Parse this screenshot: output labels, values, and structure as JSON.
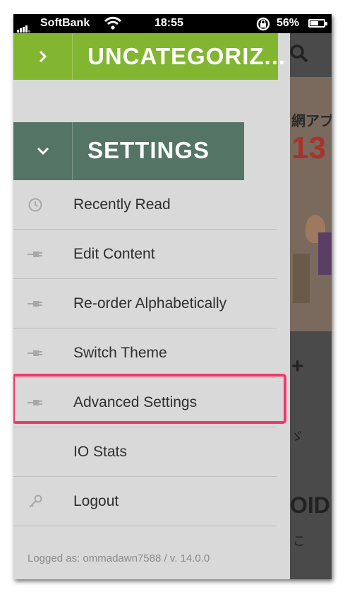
{
  "status_bar": {
    "carrier": "SoftBank",
    "time": "18:55",
    "battery": "56%"
  },
  "drawer": {
    "category_collapsed": {
      "label": "UNCATEGORIZ...",
      "icon": "chevron-right-icon"
    },
    "category_expanded": {
      "label": "SETTINGS",
      "icon": "chevron-down-icon"
    },
    "items": [
      {
        "label": "Recently Read",
        "icon": "clock-icon"
      },
      {
        "label": "Edit Content",
        "icon": "plug-icon"
      },
      {
        "label": "Re-order Alphabetically",
        "icon": "plug-icon"
      },
      {
        "label": "Switch Theme",
        "icon": "plug-icon"
      },
      {
        "label": "Advanced Settings",
        "icon": "plug-icon",
        "highlighted": true
      },
      {
        "label": "IO Stats",
        "icon": ""
      },
      {
        "label": "Logout",
        "icon": "key-icon"
      }
    ],
    "footer": "Logged as: ommadawn7588 / v. 14.0.0"
  },
  "background": {
    "banner_text": "網アプ",
    "banner_number": "13",
    "plus": "+",
    "mark": "ゞ",
    "word": "OID",
    "char": "こ"
  },
  "colors": {
    "uncategorized_bar": "#82b631",
    "settings_bar": "#547466",
    "drawer_bg": "#d9d9d9",
    "highlight_border": "#f0386e"
  }
}
